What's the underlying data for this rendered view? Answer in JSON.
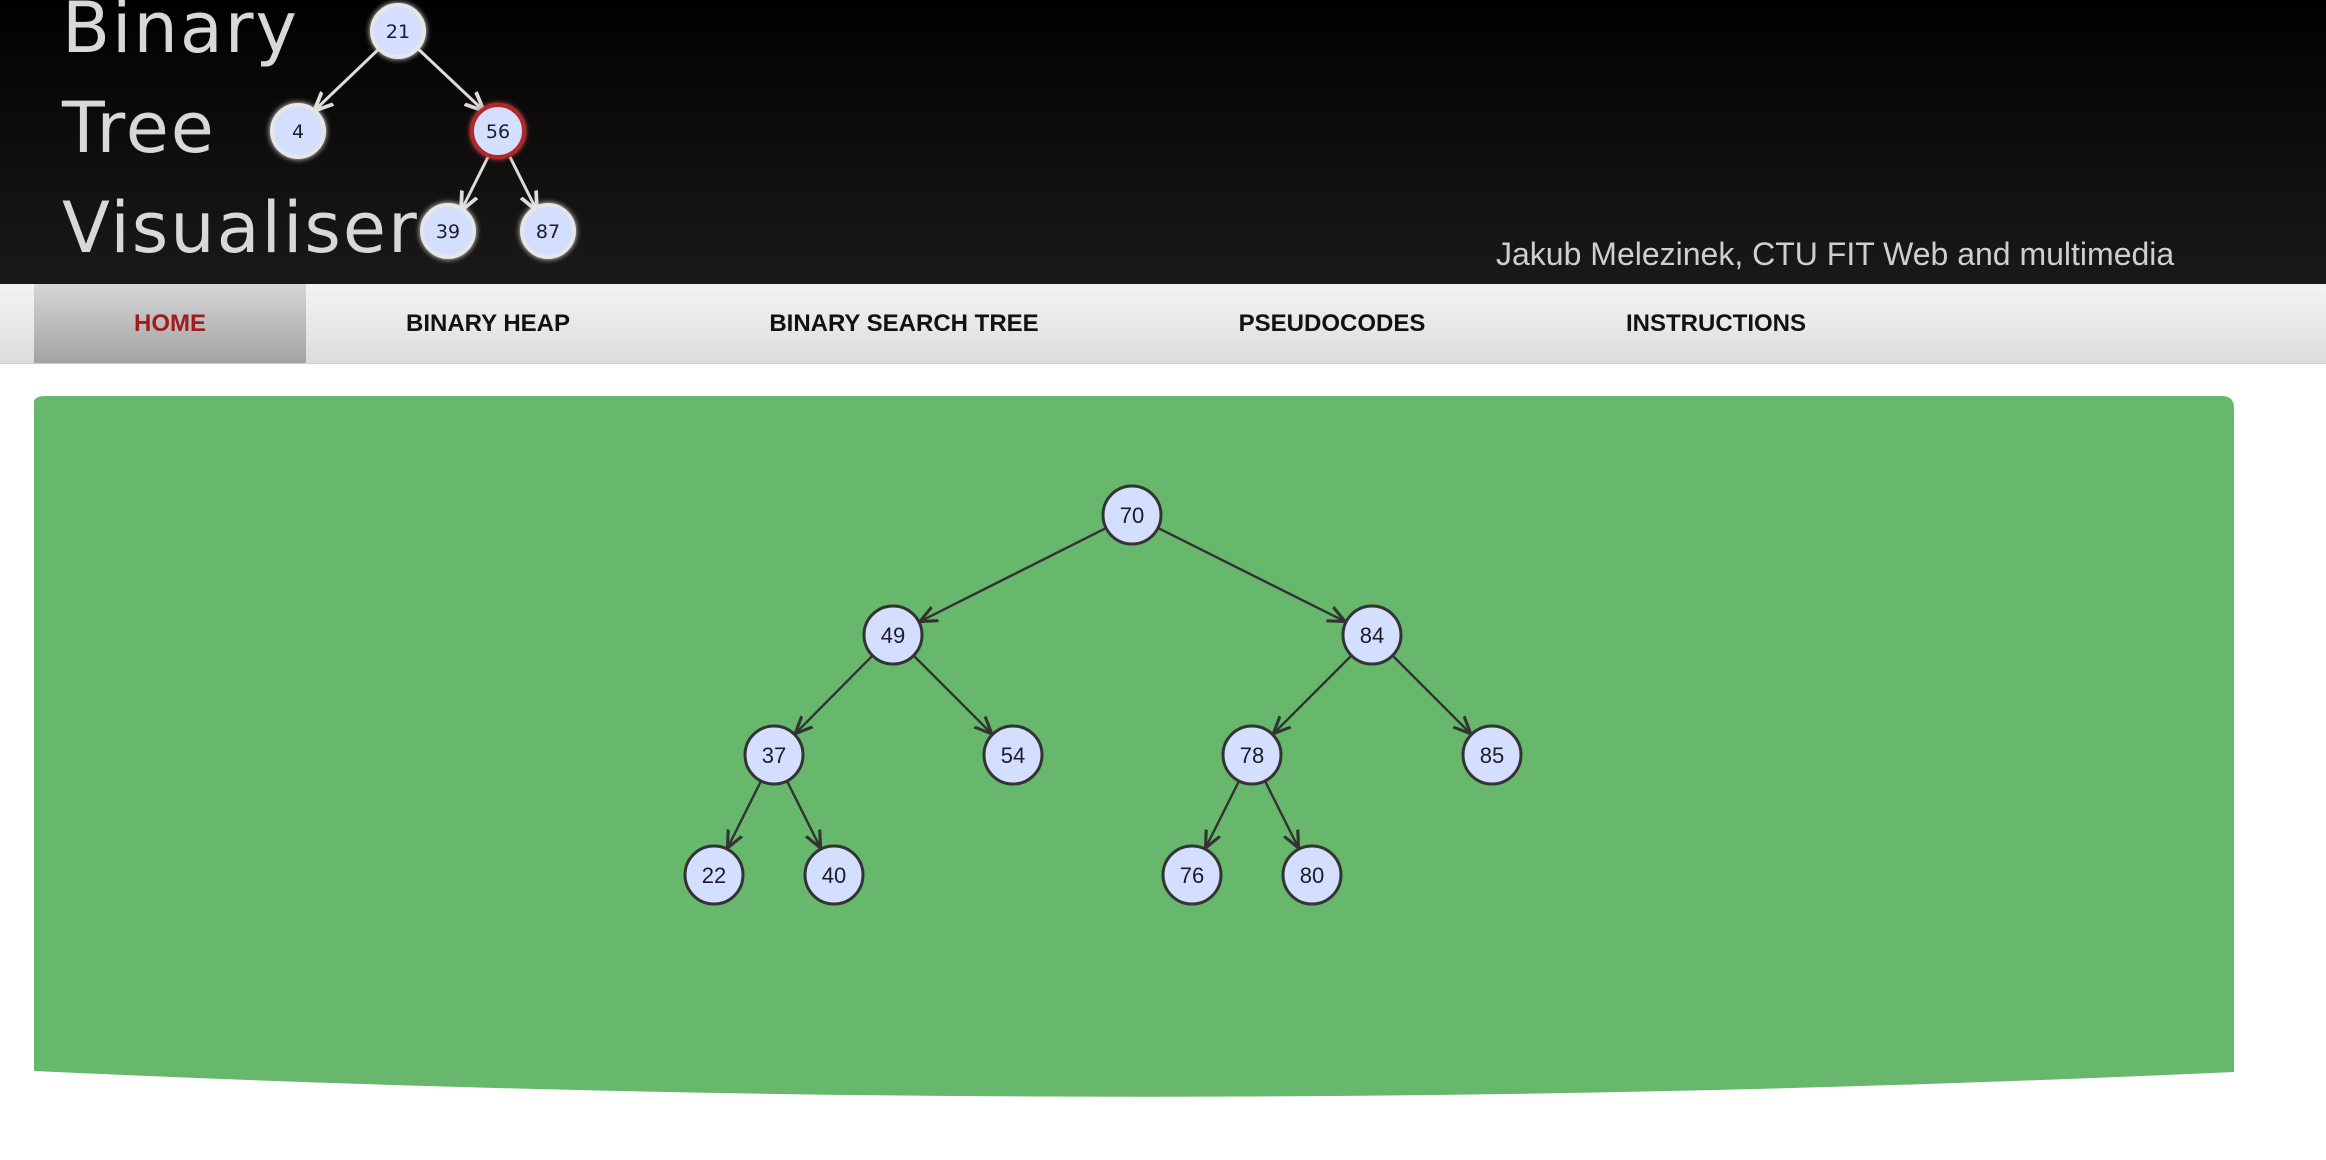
{
  "header": {
    "logo_lines": [
      "Binary",
      "Tree",
      "Visualiser"
    ],
    "logo_tree": {
      "nodes": [
        "21",
        "4",
        "56",
        "39",
        "87"
      ],
      "highlighted": "56"
    },
    "author": "Jakub Melezinek, CTU FIT Web and multimedia"
  },
  "nav": {
    "items": [
      {
        "label": "HOME",
        "active": true
      },
      {
        "label": "BINARY HEAP",
        "active": false
      },
      {
        "label": "BINARY SEARCH TREE",
        "active": false
      },
      {
        "label": "PSEUDOCODES",
        "active": false
      },
      {
        "label": "INSTRUCTIONS",
        "active": false
      }
    ]
  },
  "tree": {
    "nodes": [
      "70",
      "49",
      "84",
      "37",
      "54",
      "78",
      "85",
      "22",
      "40",
      "76",
      "80"
    ],
    "edges": [
      [
        "70",
        "49"
      ],
      [
        "70",
        "84"
      ],
      [
        "49",
        "37"
      ],
      [
        "49",
        "54"
      ],
      [
        "84",
        "78"
      ],
      [
        "84",
        "85"
      ],
      [
        "37",
        "22"
      ],
      [
        "37",
        "40"
      ],
      [
        "78",
        "76"
      ],
      [
        "78",
        "80"
      ]
    ]
  },
  "colors": {
    "stage_green": "#67b76c",
    "node_fill": "#d4deff",
    "node_stroke": "#333333",
    "edge": "#333333",
    "active_nav_text": "#a11c1c",
    "logo_highlight_ring": "#b52525"
  }
}
